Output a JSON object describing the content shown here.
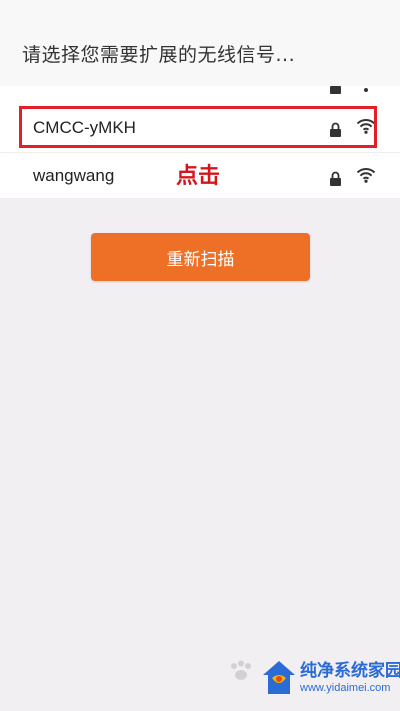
{
  "header": {
    "title": "请选择您需要扩展的无线信号..."
  },
  "networks": [
    {
      "ssid": "CMCC-yMKH",
      "secured": true,
      "signal_icon": "wifi-icon"
    },
    {
      "ssid": "wangwang",
      "secured": true,
      "signal_icon": "wifi-icon"
    }
  ],
  "annotation": {
    "text": "点击"
  },
  "actions": {
    "rescan_label": "重新扫描"
  },
  "watermark": {
    "line1": "纯净系统家园",
    "line2": "www.yidaimei.com"
  },
  "colors": {
    "accent_orange": "#ee7026",
    "highlight_red": "#e2202a",
    "annotation_red": "#d7141b",
    "watermark_blue": "#2a6bd6"
  }
}
